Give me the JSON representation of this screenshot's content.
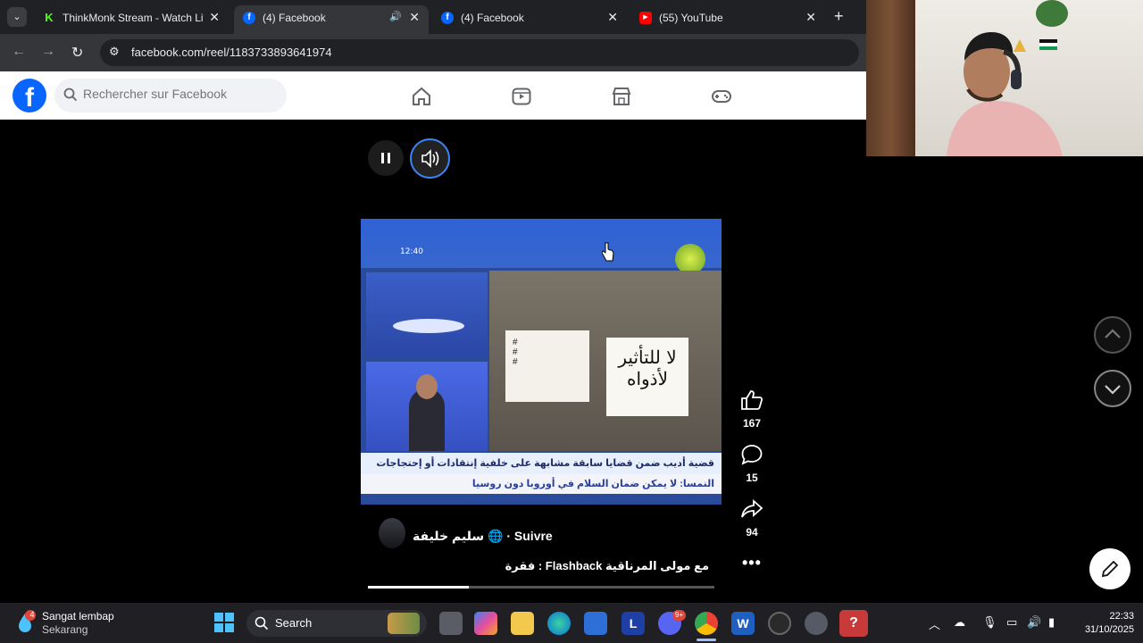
{
  "browser": {
    "tabs": [
      {
        "title": "ThinkMonk Stream - Watch Live",
        "favicon": "K",
        "favicon_color": "#53fc18",
        "active": false
      },
      {
        "title": "(4) Facebook",
        "favicon": "f",
        "favicon_color": "#0866ff",
        "active": true
      },
      {
        "title": "(4) Facebook",
        "favicon": "f",
        "favicon_color": "#0866ff",
        "active": false
      },
      {
        "title": "(55) YouTube",
        "favicon": "▶",
        "favicon_color": "#ff0000",
        "active": false
      }
    ],
    "url": "facebook.com/reel/1183733893641974"
  },
  "facebook": {
    "search_placeholder": "Rechercher sur Facebook",
    "nav_icons": [
      "home-icon",
      "video-icon",
      "marketplace-icon",
      "gaming-icon"
    ],
    "brand_color": "#0866ff"
  },
  "reel": {
    "progress_fraction": 0.29,
    "video": {
      "time": "12:40",
      "ticker_top": "قضية أديب ضمن قضايا سابقة مشابهة على خلفية إنتقادات أو إحتجاجات",
      "ticker_bottom": "النمسا: لا يمكن ضمان السلام في أوروبا دون روسيا",
      "sign_text": "لا للتأثير لأذواه"
    },
    "author": "سليم خليفة",
    "follow_label": "Suivre",
    "caption": "فقرة : Flashback مع مولى المرناقية",
    "likes": "167",
    "comments": "15",
    "shares": "94"
  },
  "taskbar": {
    "weather_badge": "4",
    "weather_title": "Sangat lembap",
    "weather_sub": "Sekarang",
    "search_label": "Search",
    "time": "22:33",
    "date": "31/10/2025",
    "discord_badge": "9+"
  }
}
